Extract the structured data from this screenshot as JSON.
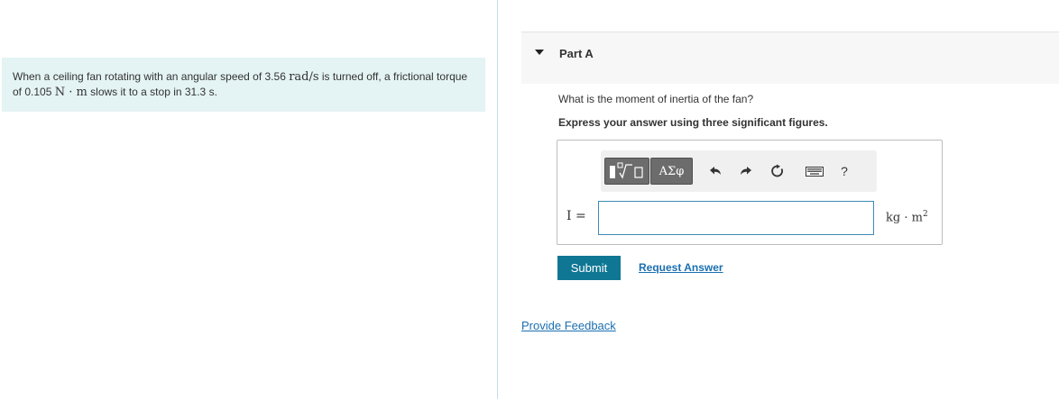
{
  "problem": {
    "text_1": "When a ceiling fan rotating with an angular speed of 3.56 ",
    "unit_1": "rad/s",
    "text_2": " is turned off, a frictional torque of 0.105 ",
    "unit_2": "N · m",
    "text_3": " slows it to a stop in 31.3 s."
  },
  "part": {
    "title": "Part A",
    "question": "What is the moment of inertia of the fan?",
    "instruction": "Express your answer using three significant figures."
  },
  "toolbar": {
    "greek_label": "ΑΣφ",
    "help_label": "?",
    "icons": [
      "templates-icon",
      "greek-letters-icon",
      "undo-icon",
      "redo-icon",
      "reset-icon",
      "keyboard-icon",
      "help-icon"
    ]
  },
  "answer": {
    "variable": "I =",
    "value": "",
    "unit_base": "kg · m",
    "unit_exp": "2"
  },
  "actions": {
    "submit_label": "Submit",
    "request_label": "Request Answer",
    "feedback_label": "Provide Feedback"
  },
  "colors": {
    "problem_bg": "#e4f3f3",
    "submit_bg": "#0f7694",
    "link": "#1a6fb0",
    "input_border": "#3d8bb3"
  }
}
